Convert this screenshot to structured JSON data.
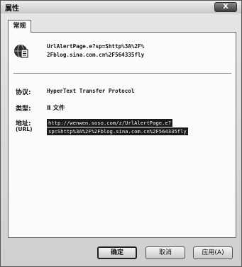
{
  "window": {
    "title": "属性",
    "close_label": "X"
  },
  "tabs": [
    {
      "label": "常规"
    }
  ],
  "file": {
    "icon": "internet-shortcut-icon",
    "name_line1": "UrlAlertPage.e?sp=Shttp%3A%2F%",
    "name_line2": "2Fblog.sina.com.cn%2F564335fly"
  },
  "properties": {
    "protocol_label": "协议:",
    "protocol_value": "HyperText Transfer Protocol",
    "type_label": "类型:",
    "type_value": "Ⅱ 文件",
    "address_label": "地址:",
    "address_sublabel": "(URL)",
    "address_line1": "http://wenwen.soso.com/z/UrlAlertPage.e?",
    "address_line2": "sp=Shttp%3A%2F%2Fblog.sina.com.cn%2F564335fly"
  },
  "buttons": {
    "ok": "确定",
    "cancel": "取消",
    "apply": "应用(A)"
  }
}
